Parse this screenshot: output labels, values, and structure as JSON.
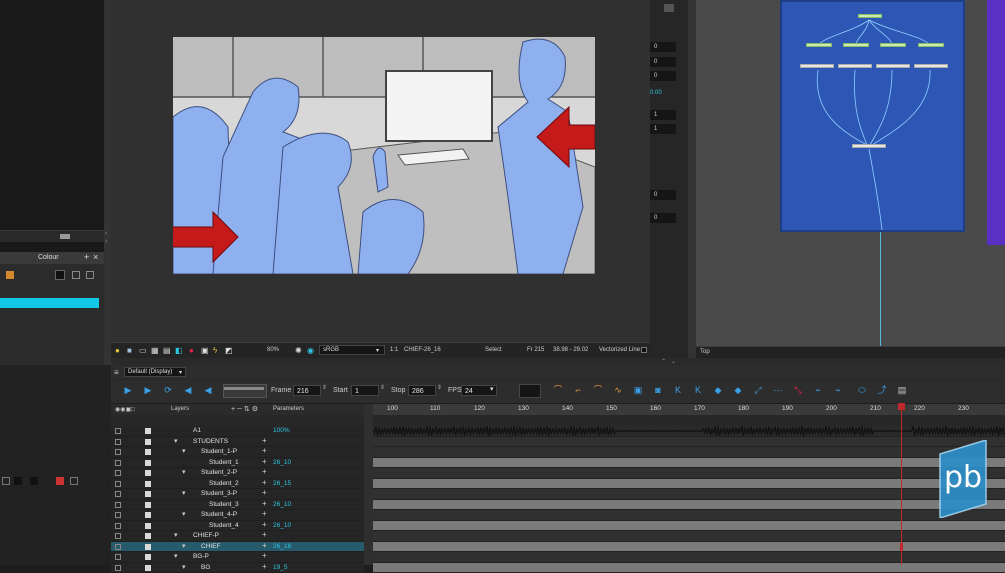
{
  "colour_panel": {
    "title": "Colour"
  },
  "view_toolbar": {
    "zoom": "80%",
    "color_space": "sRGB",
    "ratio": "1:1",
    "drawing": "CHIEF-26_16",
    "tool": "Select",
    "frame_info": "Fr 215",
    "coords": "38.98 - 29.02",
    "mode": "Vectorized Line"
  },
  "tool_props": {
    "fields": [
      "0",
      "0",
      "0",
      "1",
      "1",
      "0",
      "0"
    ],
    "value_label": "0.00"
  },
  "node_view": {
    "footer": "Top"
  },
  "timeline": {
    "display": "Default (Display)",
    "frame_label": "Frame",
    "frame_value": "216",
    "start_label": "Start",
    "start_value": "1",
    "stop_label": "Stop",
    "stop_value": "286",
    "fps_label": "FPS",
    "fps_value": "24",
    "layers_header": "Layers",
    "params_header": "Parameters",
    "ruler": [
      "100",
      "110",
      "120",
      "130",
      "140",
      "150",
      "160",
      "170",
      "180",
      "190",
      "200",
      "210",
      "220",
      "230"
    ],
    "layers": [
      {
        "name": "A1",
        "param": "100%",
        "indent": 0,
        "track": "wave"
      },
      {
        "name": "STUDENTS",
        "param": "",
        "indent": 0,
        "track": "empty"
      },
      {
        "name": "Student_1-P",
        "param": "",
        "indent": 1,
        "track": "empty"
      },
      {
        "name": "Student_1",
        "param": "26_10",
        "indent": 2,
        "track": "full"
      },
      {
        "name": "Student_2-P",
        "param": "",
        "indent": 1,
        "track": "empty"
      },
      {
        "name": "Student_2",
        "param": "26_15",
        "indent": 2,
        "track": "full"
      },
      {
        "name": "Student_3-P",
        "param": "",
        "indent": 1,
        "track": "empty"
      },
      {
        "name": "Student_3",
        "param": "26_10",
        "indent": 2,
        "track": "full"
      },
      {
        "name": "Student_4-P",
        "param": "",
        "indent": 1,
        "track": "empty"
      },
      {
        "name": "Student_4",
        "param": "26_10",
        "indent": 2,
        "track": "full"
      },
      {
        "name": "CHIEF-P",
        "param": "",
        "indent": 0,
        "track": "empty"
      },
      {
        "name": "CHIEF",
        "param": "26_16",
        "indent": 1,
        "track": "full",
        "selected": true
      },
      {
        "name": "BG-P",
        "param": "",
        "indent": 0,
        "track": "empty"
      },
      {
        "name": "BG",
        "param": "19_5",
        "indent": 1,
        "track": "full"
      }
    ]
  },
  "logo": {
    "text": "pb"
  },
  "colors": {
    "accent": "#12c8e6",
    "scrubber": "#c0282c",
    "node_bg": "#2e57b5",
    "arrow": "#c41a1a",
    "character_fill": "#8fb0ef"
  }
}
